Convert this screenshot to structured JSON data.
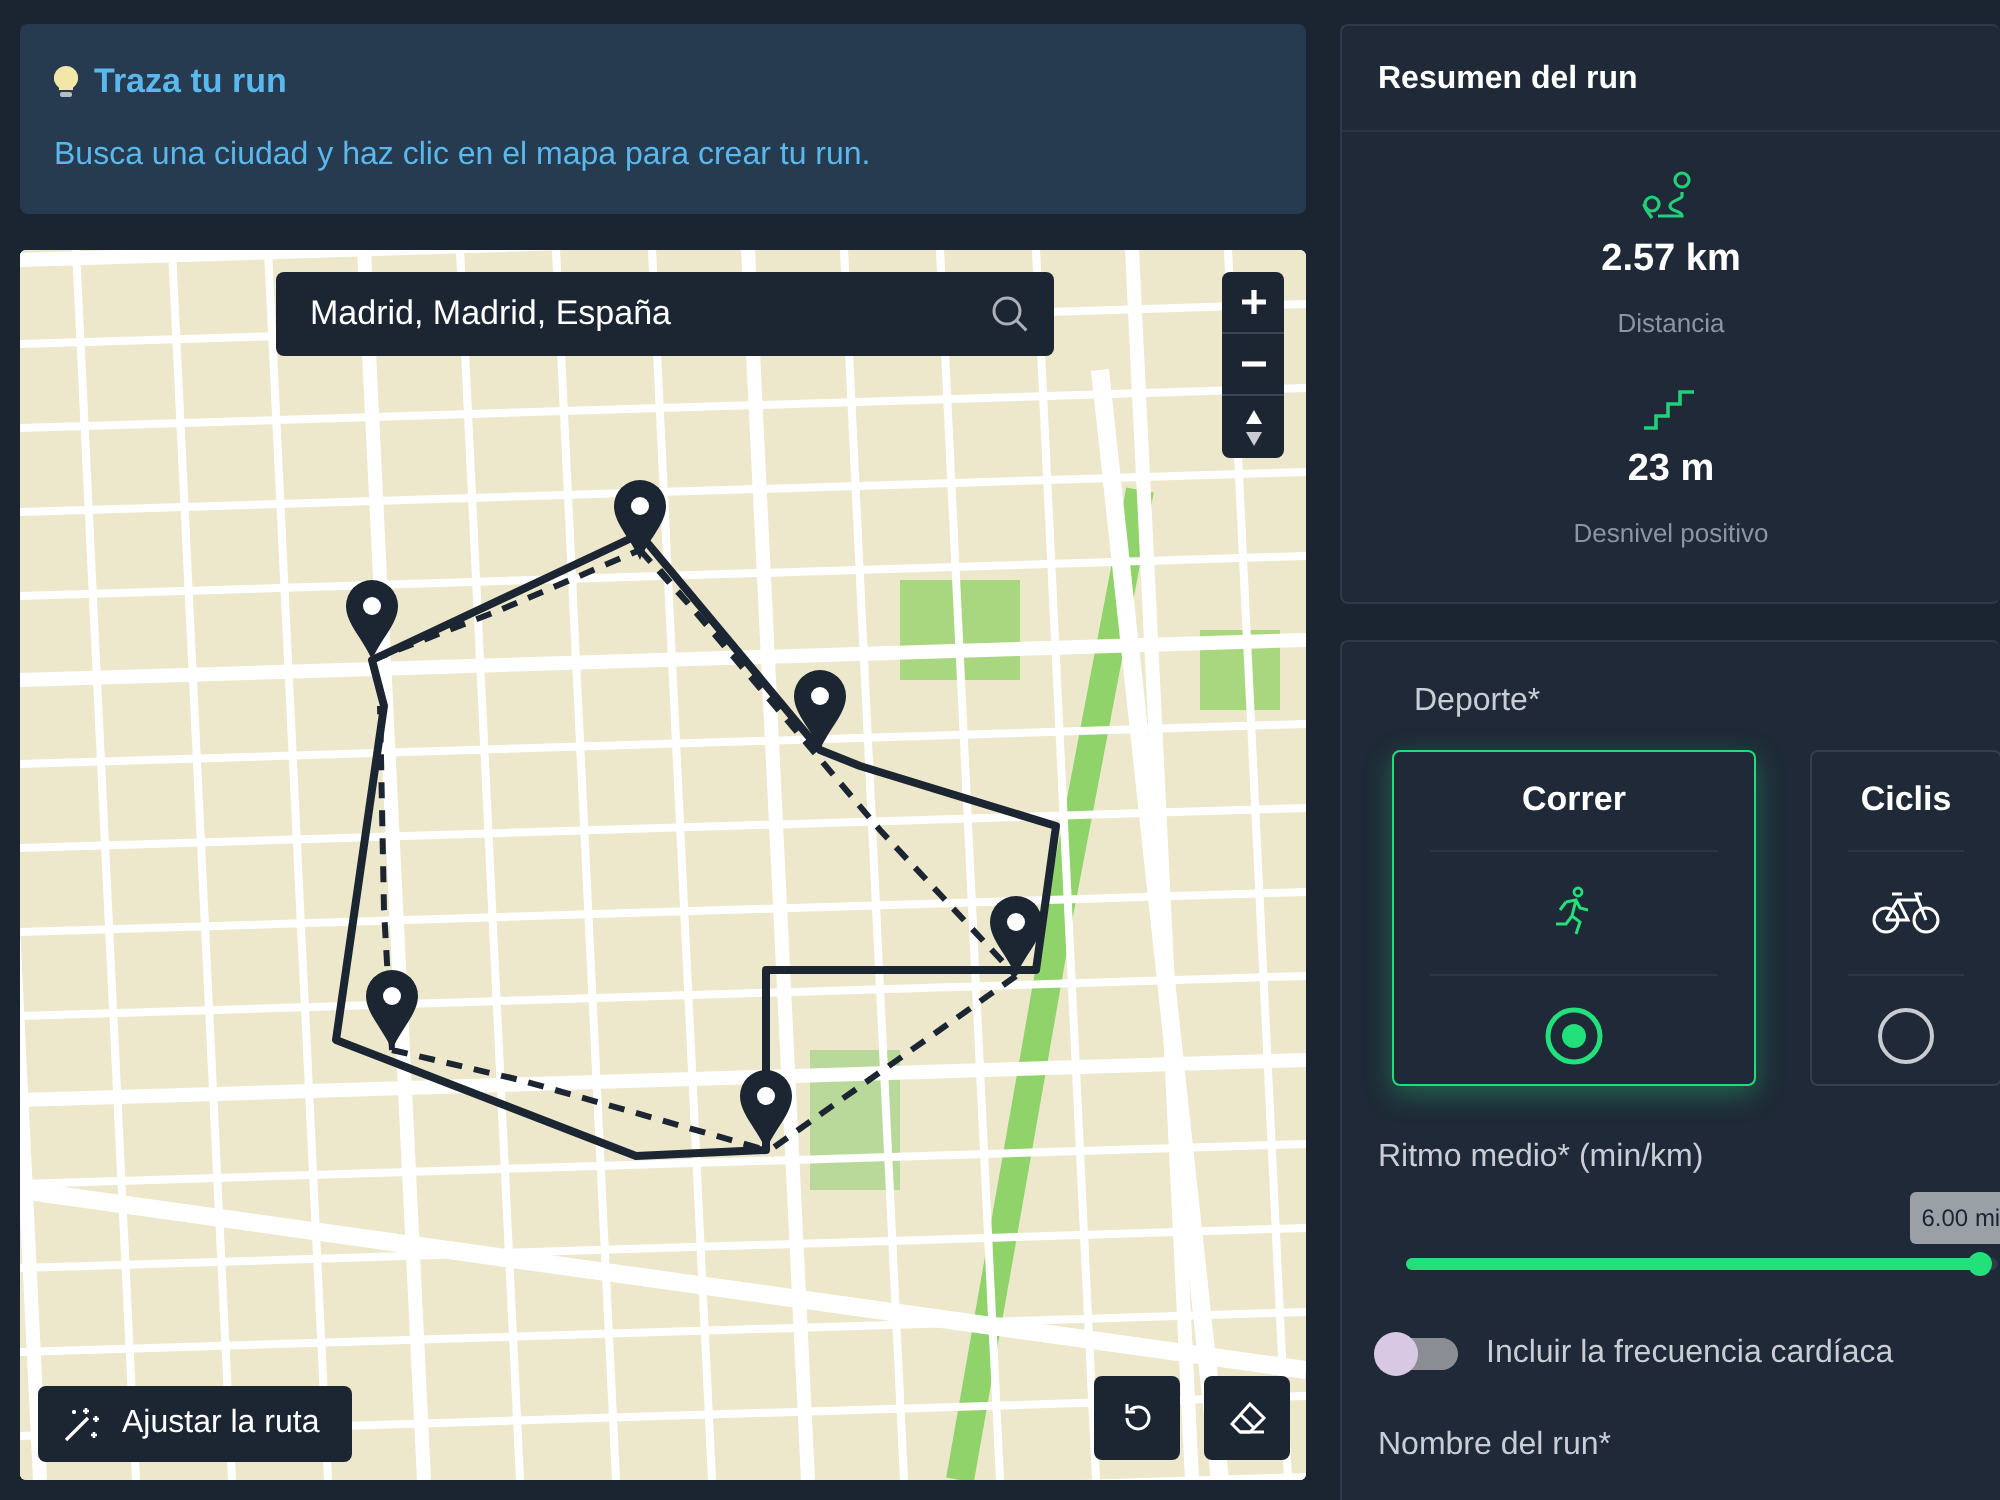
{
  "hint": {
    "title": "Traza tu run",
    "text": "Busca una ciudad y haz clic en el mapa para crear tu run."
  },
  "map": {
    "search_value": "Madrid, Madrid, España",
    "adjust_button": "Ajustar la ruta"
  },
  "summary": {
    "title": "Resumen del run",
    "stats": [
      {
        "kind": "distance",
        "value": "2.57 km",
        "label": "Distancia"
      },
      {
        "kind": "elevation",
        "value": "23 m",
        "label": "Desnivel positivo"
      }
    ]
  },
  "sport": {
    "label": "Deporte*",
    "options": [
      {
        "kind": "run",
        "label": "Correr",
        "selected": true
      },
      {
        "kind": "bike",
        "label": "Ciclis",
        "selected": false
      }
    ]
  },
  "pace": {
    "label": "Ritmo medio* (min/km)",
    "level": 0.97,
    "reading": "6.00 mi"
  },
  "heart_rate": {
    "label": "Incluir la frecuencia cardíaca",
    "on": false
  },
  "name_field": {
    "label": "Nombre del run*"
  }
}
